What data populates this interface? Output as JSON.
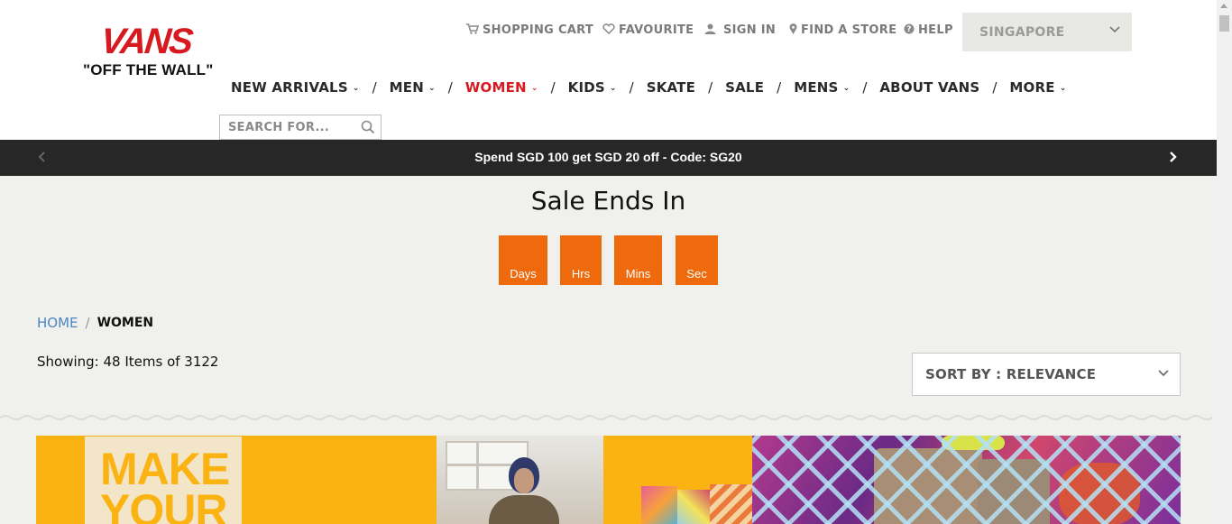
{
  "brand": {
    "logo_text": "VANS",
    "tagline": "\"OFF THE WALL\"",
    "accent_color": "#d71920"
  },
  "utility": {
    "cart": "SHOPPING CART",
    "favourite": "FAVOURITE",
    "sign_in": "SIGN IN",
    "find_store": "FIND A STORE",
    "help": "HELP",
    "country": "SINGAPORE"
  },
  "nav": {
    "items": [
      {
        "label": "NEW ARRIVALS",
        "dropdown": true
      },
      {
        "label": "MEN",
        "dropdown": true
      },
      {
        "label": "WOMEN",
        "dropdown": true,
        "active": true
      },
      {
        "label": "KIDS",
        "dropdown": true
      },
      {
        "label": "SKATE",
        "dropdown": false
      },
      {
        "label": "SALE",
        "dropdown": false
      },
      {
        "label": "MENS",
        "dropdown": true
      },
      {
        "label": "ABOUT VANS",
        "dropdown": false
      },
      {
        "label": "MORE",
        "dropdown": true
      }
    ],
    "separator": "/"
  },
  "search": {
    "placeholder": "SEARCH FOR..."
  },
  "promo": {
    "text": "Spend SGD 100 get SGD 20 off - Code: SG20",
    "bar_color": "#272727"
  },
  "countdown": {
    "title": "Sale Ends In",
    "units": [
      "Days",
      "Hrs",
      "Mins",
      "Sec"
    ],
    "box_color": "#ee6a0c"
  },
  "breadcrumb": {
    "home": "HOME",
    "separator": "/",
    "current": "WOMEN"
  },
  "results": {
    "showing": "Showing: 48 Items of 3122"
  },
  "sort": {
    "label": "SORT BY : RELEVANCE"
  },
  "banner": {
    "headline_line1": "MAKE",
    "headline_line2": "YOUR",
    "background_color": "#fbb313"
  }
}
